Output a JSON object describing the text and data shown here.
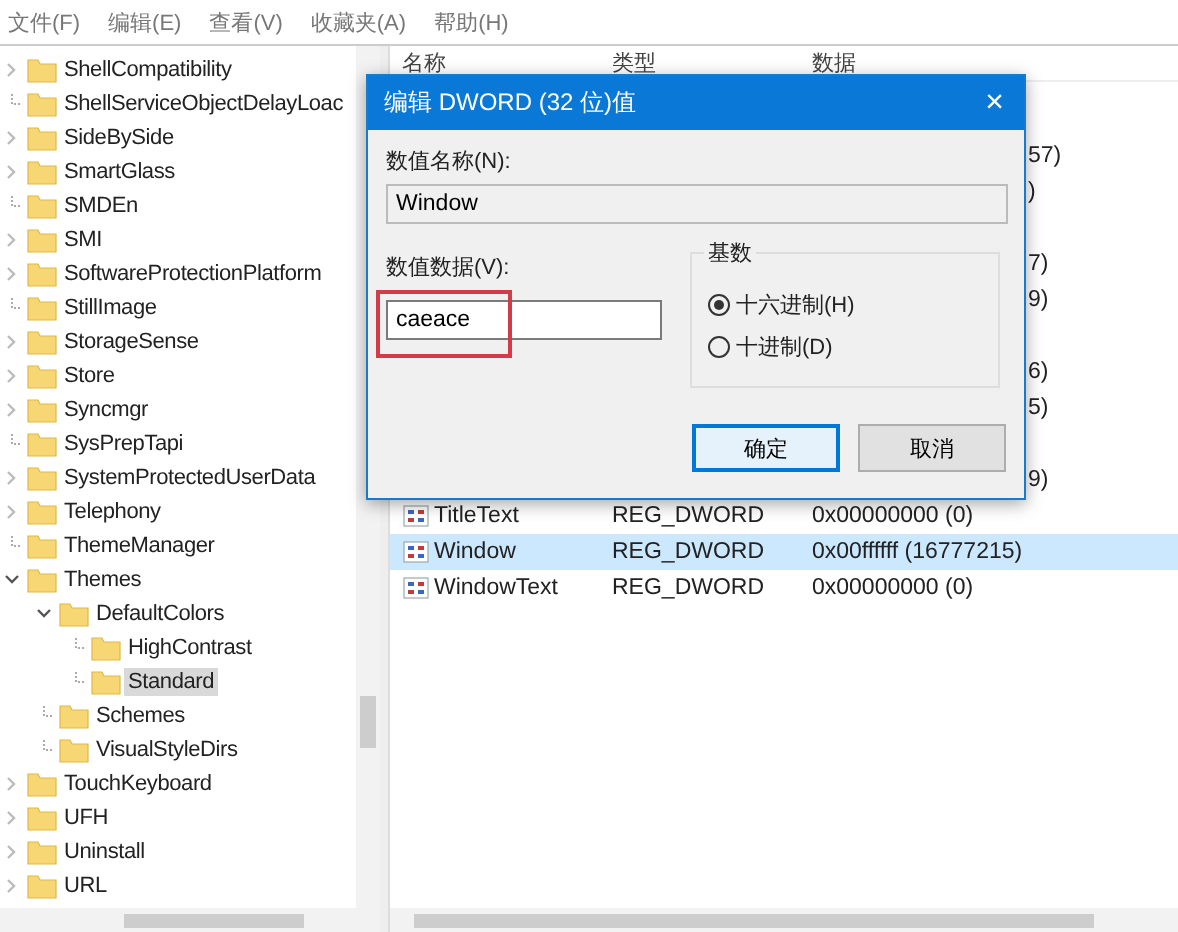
{
  "menu": [
    "文件(F)",
    "编辑(E)",
    "查看(V)",
    "收藏夹(A)",
    "帮助(H)"
  ],
  "tree": [
    {
      "label": "ShellCompatibility",
      "kind": "branch",
      "expanded": false,
      "selected": false
    },
    {
      "label": "ShellServiceObjectDelayLoac",
      "kind": "leaf",
      "selected": false
    },
    {
      "label": "SideBySide",
      "kind": "branch",
      "expanded": false,
      "selected": false
    },
    {
      "label": "SmartGlass",
      "kind": "branch",
      "expanded": false,
      "selected": false
    },
    {
      "label": "SMDEn",
      "kind": "leaf",
      "selected": false
    },
    {
      "label": "SMI",
      "kind": "branch",
      "expanded": false,
      "selected": false
    },
    {
      "label": "SoftwareProtectionPlatform",
      "kind": "branch",
      "expanded": false,
      "selected": false
    },
    {
      "label": "StillImage",
      "kind": "leaf",
      "selected": false
    },
    {
      "label": "StorageSense",
      "kind": "branch",
      "expanded": false,
      "selected": false
    },
    {
      "label": "Store",
      "kind": "branch",
      "expanded": false,
      "selected": false
    },
    {
      "label": "Syncmgr",
      "kind": "branch",
      "expanded": false,
      "selected": false
    },
    {
      "label": "SysPrepTapi",
      "kind": "leaf",
      "selected": false
    },
    {
      "label": "SystemProtectedUserData",
      "kind": "branch",
      "expanded": false,
      "selected": false
    },
    {
      "label": "Telephony",
      "kind": "branch",
      "expanded": false,
      "selected": false
    },
    {
      "label": "ThemeManager",
      "kind": "leaf",
      "selected": false
    },
    {
      "label": "Themes",
      "kind": "branch",
      "expanded": true,
      "selected": false,
      "children": [
        {
          "label": "DefaultColors",
          "kind": "branch",
          "expanded": true,
          "selected": false,
          "children": [
            {
              "label": "HighContrast",
              "kind": "leaf",
              "selected": false
            },
            {
              "label": "Standard",
              "kind": "leaf",
              "selected": true
            }
          ]
        },
        {
          "label": "Schemes",
          "kind": "leaf",
          "selected": false
        },
        {
          "label": "VisualStyleDirs",
          "kind": "leaf",
          "selected": false
        }
      ]
    },
    {
      "label": "TouchKeyboard",
      "kind": "branch",
      "expanded": false,
      "selected": false
    },
    {
      "label": "UFH",
      "kind": "branch",
      "expanded": false,
      "selected": false
    },
    {
      "label": "Uninstall",
      "kind": "branch",
      "expanded": false,
      "selected": false
    },
    {
      "label": "URL",
      "kind": "branch",
      "expanded": false,
      "selected": false
    }
  ],
  "table": {
    "columns": [
      "名称",
      "类型",
      "数据"
    ],
    "rows": [
      {
        "kind": "partial",
        "data": "57)",
        "selected": false
      },
      {
        "kind": "partial",
        "data": ")",
        "selected": false
      },
      {
        "kind": "hidden",
        "selected": false
      },
      {
        "kind": "partial",
        "data": "7)",
        "selected": false
      },
      {
        "kind": "partial",
        "data": "9)",
        "selected": false
      },
      {
        "kind": "hidden",
        "selected": false
      },
      {
        "kind": "partial",
        "data": "6)",
        "selected": false
      },
      {
        "kind": "partial",
        "data": "5)",
        "selected": false
      },
      {
        "kind": "hidden",
        "selected": false
      },
      {
        "kind": "partial",
        "data": "9)",
        "selected": false
      },
      {
        "kind": "value",
        "name": "TitleText",
        "type": "REG_DWORD",
        "data": "0x00000000 (0)",
        "selected": false
      },
      {
        "kind": "value",
        "name": "Window",
        "type": "REG_DWORD",
        "data": "0x00ffffff (16777215)",
        "selected": true
      },
      {
        "kind": "value",
        "name": "WindowText",
        "type": "REG_DWORD",
        "data": "0x00000000 (0)",
        "selected": false
      }
    ]
  },
  "dialog": {
    "title": "编辑 DWORD (32 位)值",
    "close": "×",
    "name_label": "数值名称(N):",
    "name_value": "Window",
    "data_label": "数值数据(V):",
    "data_value": "caeace",
    "data_highlighted": true,
    "base_label": "基数",
    "bases": [
      {
        "label": "十六进制(H)",
        "selected": true
      },
      {
        "label": "十进制(D)",
        "selected": false
      }
    ],
    "buttons": [
      {
        "label": "确定",
        "default": true
      },
      {
        "label": "取消",
        "default": false
      }
    ]
  }
}
